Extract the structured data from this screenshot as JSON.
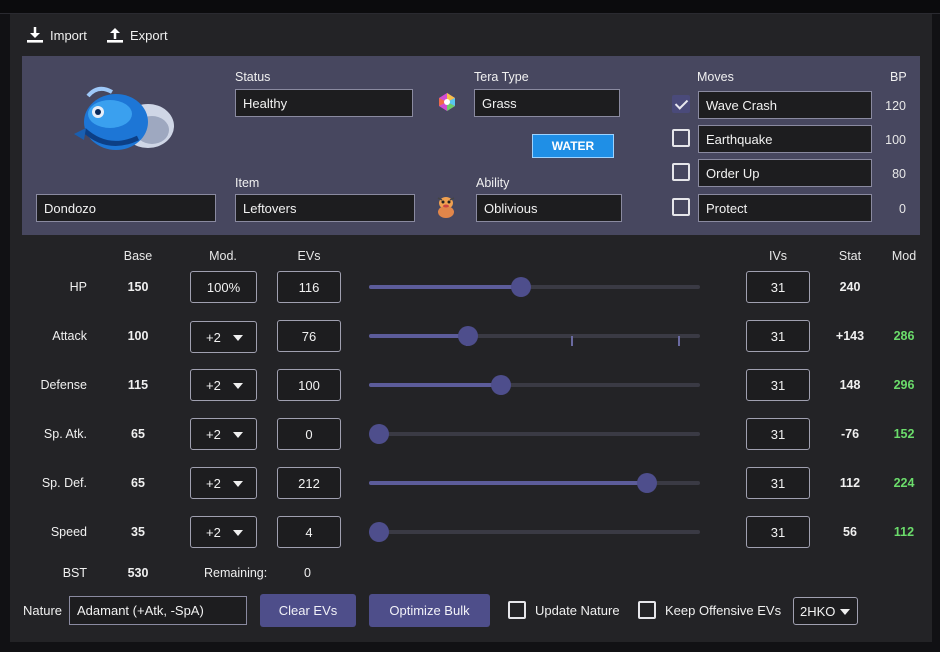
{
  "toolbar": {
    "import_label": "Import",
    "export_label": "Export"
  },
  "pokemon": {
    "name": "Dondozo",
    "status_label": "Status",
    "status": "Healthy",
    "tera_label": "Tera Type",
    "tera": "Grass",
    "tera_badge": "WATER",
    "item_label": "Item",
    "item": "Leftovers",
    "ability_label": "Ability",
    "ability": "Oblivious",
    "moves_label": "Moves",
    "bp_label": "BP",
    "moves": [
      {
        "name": "Wave Crash",
        "bp": "120",
        "checked": true
      },
      {
        "name": "Earthquake",
        "bp": "100",
        "checked": false
      },
      {
        "name": "Order Up",
        "bp": "80",
        "checked": false
      },
      {
        "name": "Protect",
        "bp": "0",
        "checked": false
      }
    ]
  },
  "stats": {
    "headers": {
      "base": "Base",
      "mod": "Mod.",
      "evs": "EVs",
      "ivs": "IVs",
      "stat": "Stat",
      "mod2": "Mod"
    },
    "rows": [
      {
        "label": "HP",
        "base": "150",
        "mod": "100%",
        "ev": "116",
        "ev_fraction": 0.45,
        "iv": "31",
        "stat": "240",
        "modstat": ""
      },
      {
        "label": "Attack",
        "base": "100",
        "mod": "+2",
        "ev": "76",
        "ev_fraction": 0.29,
        "iv": "31",
        "stat": "+143",
        "modstat": "286"
      },
      {
        "label": "Defense",
        "base": "115",
        "mod": "+2",
        "ev": "100",
        "ev_fraction": 0.39,
        "iv": "31",
        "stat": "148",
        "modstat": "296"
      },
      {
        "label": "Sp. Atk.",
        "base": "65",
        "mod": "+2",
        "ev": "0",
        "ev_fraction": 0.0,
        "iv": "31",
        "stat": "-76",
        "modstat": "152"
      },
      {
        "label": "Sp. Def.",
        "base": "65",
        "mod": "+2",
        "ev": "212",
        "ev_fraction": 0.83,
        "iv": "31",
        "stat": "112",
        "modstat": "224"
      },
      {
        "label": "Speed",
        "base": "35",
        "mod": "+2",
        "ev": "4",
        "ev_fraction": 0.02,
        "iv": "31",
        "stat": "56",
        "modstat": "112"
      }
    ],
    "bst_label": "BST",
    "bst": "530",
    "remaining_label": "Remaining:",
    "remaining": "0"
  },
  "footer": {
    "nature_label": "Nature",
    "nature": "Adamant (+Atk, -SpA)",
    "clear_evs": "Clear EVs",
    "optimize": "Optimize Bulk",
    "update_nature": "Update Nature",
    "keep_offensive": "Keep Offensive EVs",
    "ko_select": "2HKO"
  },
  "colors": {
    "accent": "#4e4e8a",
    "panel": "#47475f",
    "green": "#6bdc6b",
    "water": "#1f8fe6"
  }
}
